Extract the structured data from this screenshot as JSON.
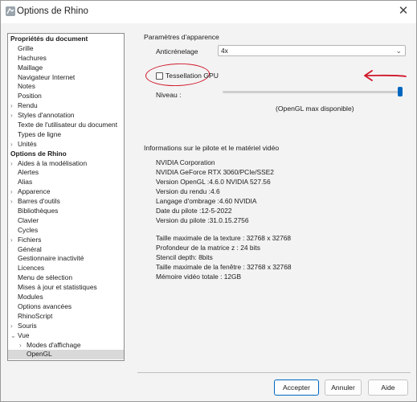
{
  "window": {
    "title": "Options de Rhino",
    "close_glyph": "✕",
    "accent_color": "#0067c0",
    "annotation_color": "#d0172a"
  },
  "tree": {
    "items": [
      {
        "label": "Propriétés du document",
        "level": 0,
        "expandable": false
      },
      {
        "label": "Grille",
        "level": 1,
        "expandable": false
      },
      {
        "label": "Hachures",
        "level": 1,
        "expandable": false
      },
      {
        "label": "Maillage",
        "level": 1,
        "expandable": false
      },
      {
        "label": "Navigateur Internet",
        "level": 1,
        "expandable": false
      },
      {
        "label": "Notes",
        "level": 1,
        "expandable": false
      },
      {
        "label": "Position",
        "level": 1,
        "expandable": false
      },
      {
        "label": "Rendu",
        "level": 1,
        "expandable": true
      },
      {
        "label": "Styles d'annotation",
        "level": 1,
        "expandable": true
      },
      {
        "label": "Texte de l'utilisateur du document",
        "level": 1,
        "expandable": false
      },
      {
        "label": "Types de ligne",
        "level": 1,
        "expandable": false
      },
      {
        "label": "Unités",
        "level": 1,
        "expandable": true
      },
      {
        "label": "Options de Rhino",
        "level": 0,
        "expandable": false
      },
      {
        "label": "Aides à la modélisation",
        "level": 1,
        "expandable": true
      },
      {
        "label": "Alertes",
        "level": 1,
        "expandable": false
      },
      {
        "label": "Alias",
        "level": 1,
        "expandable": false
      },
      {
        "label": "Apparence",
        "level": 1,
        "expandable": true
      },
      {
        "label": "Barres d'outils",
        "level": 1,
        "expandable": true
      },
      {
        "label": "Bibliothèques",
        "level": 1,
        "expandable": false
      },
      {
        "label": "Clavier",
        "level": 1,
        "expandable": false
      },
      {
        "label": "Cycles",
        "level": 1,
        "expandable": false
      },
      {
        "label": "Fichiers",
        "level": 1,
        "expandable": true
      },
      {
        "label": "Général",
        "level": 1,
        "expandable": false
      },
      {
        "label": "Gestionnaire inactivité",
        "level": 1,
        "expandable": false
      },
      {
        "label": "Licences",
        "level": 1,
        "expandable": false
      },
      {
        "label": "Menu de sélection",
        "level": 1,
        "expandable": false
      },
      {
        "label": "Mises à jour et statistiques",
        "level": 1,
        "expandable": false
      },
      {
        "label": "Modules",
        "level": 1,
        "expandable": false
      },
      {
        "label": "Options avancées",
        "level": 1,
        "expandable": false
      },
      {
        "label": "RhinoScript",
        "level": 1,
        "expandable": false
      },
      {
        "label": "Souris",
        "level": 1,
        "expandable": true
      },
      {
        "label": "Vue",
        "level": 1,
        "expandable": true,
        "expanded": true
      },
      {
        "label": "Modes d'affichage",
        "level": 2,
        "expandable": true
      },
      {
        "label": "OpenGL",
        "level": 2,
        "expandable": false,
        "selected": true
      }
    ]
  },
  "appearance": {
    "section_title": "Paramètres d'apparence",
    "antialias_label": "Anticrénelage",
    "antialias_value": "4x",
    "tessellation_label": "Tessellation GPU",
    "tessellation_checked": false,
    "level_label": "Niveau :",
    "level_value_fraction": 1.0,
    "level_caption": "(OpenGL max disponible)"
  },
  "driver_info": {
    "section_title": "Informations sur le pilote et le matériel vidéo",
    "lines": [
      "NVIDIA Corporation",
      "NVIDIA GeForce RTX 3060/PCIe/SSE2",
      "Version OpenGL :4.6.0 NVIDIA 527.56",
      "Version du rendu :4.6",
      "Langage d'ombrage :4.60 NVIDIA",
      "Date du pilote :12-5-2022",
      "Version du pilote :31.0.15.2756"
    ],
    "limits": [
      "Taille maximale de la texture : 32768 x 32768",
      "Profondeur de la matrice z : 24 bits",
      "Stencil depth: 8bits",
      "Taille maximale de la fenêtre : 32768 x 32768",
      "Mémoire vidéo totale : 12GB"
    ]
  },
  "buttons": {
    "accept": "Accepter",
    "cancel": "Annuler",
    "help": "Aide"
  }
}
